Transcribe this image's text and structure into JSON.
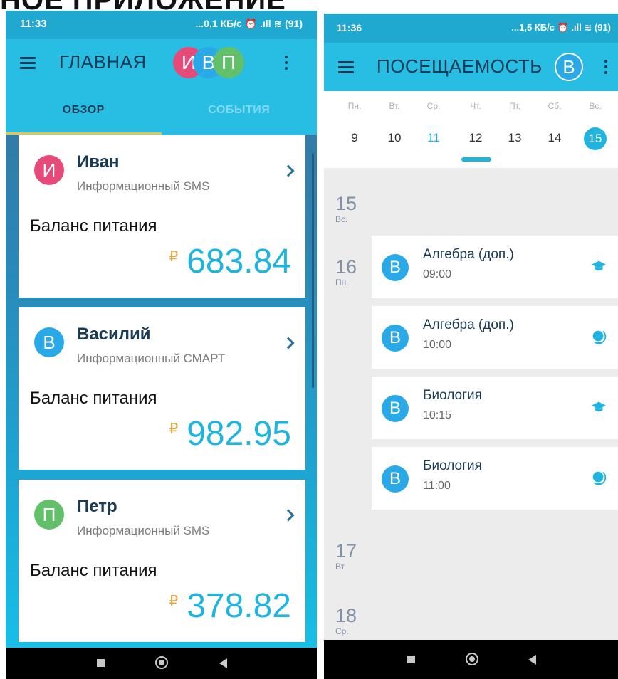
{
  "heading": "НОЕ ПРИЛОЖЕНИЕ",
  "left": {
    "status": {
      "time": "11:33",
      "right": "...0,1 КБ/с ⏰ .ıll ≋ (91)"
    },
    "appbar": {
      "title": "ГЛАВНАЯ",
      "avatars": [
        {
          "letter": "И",
          "color": "#e64a7b"
        },
        {
          "letter": "В",
          "color": "#2aa9e8"
        },
        {
          "letter": "П",
          "color": "#63c06a"
        }
      ]
    },
    "tabs": [
      {
        "label": "ОБЗОР",
        "active": true
      },
      {
        "label": "СОБЫТИЯ",
        "active": false
      }
    ],
    "cards": [
      {
        "initial": "И",
        "name": "Иван",
        "plan": "Информационный SMS",
        "balance_label": "Баланс питания",
        "currency": "₽",
        "amount": "683.84"
      },
      {
        "initial": "В",
        "name": "Василий",
        "plan": "Информационный СМАРТ",
        "balance_label": "Баланс питания",
        "currency": "₽",
        "amount": "982.95"
      },
      {
        "initial": "П",
        "name": "Петр",
        "plan": "Информационный SMS",
        "balance_label": "Баланс питания",
        "currency": "₽",
        "amount": "378.82"
      }
    ]
  },
  "right": {
    "status": {
      "time": "11:36",
      "right": "...1,5 КБ/с ⏰ .ıll ≋ (91)"
    },
    "appbar": {
      "title": "ПОСЕЩАЕМОСТЬ",
      "avatar": "В"
    },
    "week": [
      {
        "name": "Пн.",
        "num": "9"
      },
      {
        "name": "Вт.",
        "num": "10"
      },
      {
        "name": "Ср.",
        "num": "11"
      },
      {
        "name": "Чт.",
        "num": "12"
      },
      {
        "name": "Пт.",
        "num": "13"
      },
      {
        "name": "Сб.",
        "num": "14"
      },
      {
        "name": "Вс.",
        "num": "15"
      }
    ],
    "days": [
      {
        "num": "15",
        "wd": "Вс."
      },
      {
        "num": "16",
        "wd": "Пн."
      },
      {
        "num": "17",
        "wd": "Вт."
      },
      {
        "num": "18",
        "wd": "Ср."
      }
    ],
    "events": [
      {
        "initial": "В",
        "title": "Алгебра (доп.)",
        "time": "09:00",
        "icon": "graduation-cap-icon"
      },
      {
        "initial": "В",
        "title": "Алгебра (доп.)",
        "time": "10:00",
        "icon": "globe-icon"
      },
      {
        "initial": "В",
        "title": "Биология",
        "time": "10:15",
        "icon": "graduation-cap-icon"
      },
      {
        "initial": "В",
        "title": "Биология",
        "time": "11:00",
        "icon": "globe-icon"
      }
    ]
  },
  "colors": {
    "accent": "#1fb4e0",
    "appbar": "#28bde3",
    "dark_text": "#1a3b55",
    "tab_indicator": "#e8c34a"
  }
}
